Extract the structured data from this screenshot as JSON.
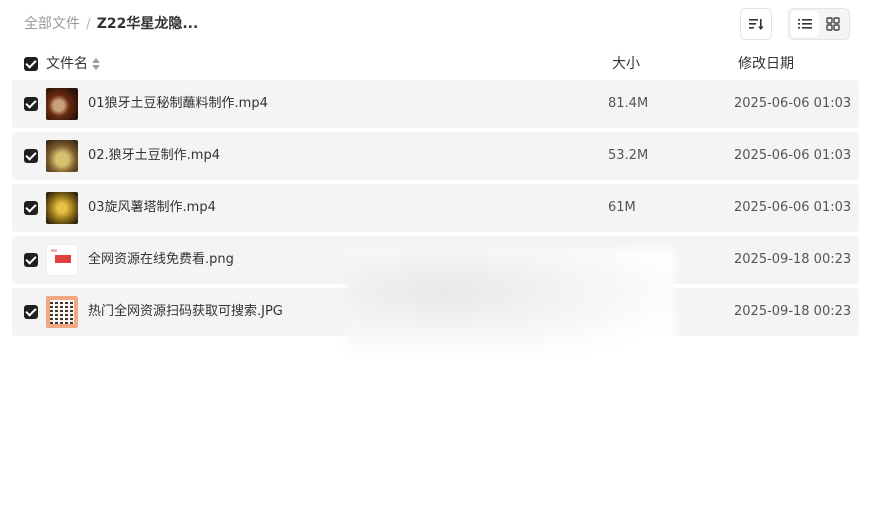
{
  "breadcrumb": {
    "root": "全部文件",
    "separator": "/",
    "current": "Z22华星龙隐..."
  },
  "toolbar": {
    "sort_icon": "sort-icon",
    "list_view_icon": "list-view-icon",
    "grid_view_icon": "grid-view-icon",
    "active_view": "list"
  },
  "columns": {
    "name": "文件名",
    "size": "大小",
    "date": "修改日期"
  },
  "files": [
    {
      "name": "01狼牙土豆秘制蘸料制作.mp4",
      "size": "81.4M",
      "date": "2025-06-06 01:03",
      "checked": true
    },
    {
      "name": "02.狼牙土豆制作.mp4",
      "size": "53.2M",
      "date": "2025-06-06 01:03",
      "checked": true
    },
    {
      "name": "03旋风薯塔制作.mp4",
      "size": "61M",
      "date": "2025-06-06 01:03",
      "checked": true
    },
    {
      "name": "全网资源在线免费看.png",
      "size": "",
      "date": "2025-09-18 00:23",
      "checked": true
    },
    {
      "name": "热门全网资源扫码获取可搜索.JPG",
      "size": "",
      "date": "2025-09-18 00:23",
      "checked": true
    }
  ],
  "colors": {
    "checkbox": "#1f1f1f",
    "row_background": "#f4f4f4"
  }
}
